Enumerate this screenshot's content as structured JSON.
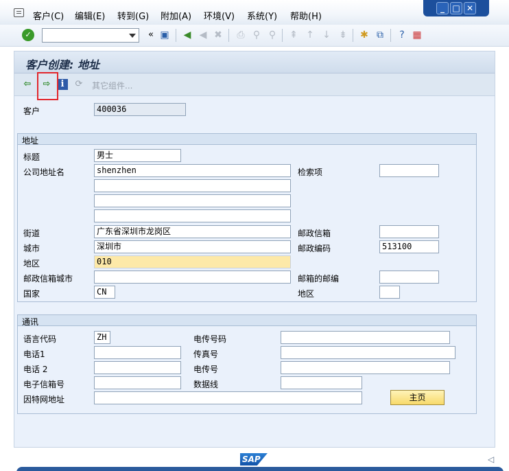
{
  "menu": {
    "items": [
      "客户(C)",
      "编辑(E)",
      "转到(G)",
      "附加(A)",
      "环境(V)",
      "系统(Y)",
      "帮助(H)"
    ]
  },
  "window_controls": [
    "_",
    "□",
    "✕"
  ],
  "toolbar": {
    "command_field_value": ""
  },
  "screen": {
    "title": "客户创建: 地址",
    "other_components_label": "其它组件..."
  },
  "customer": {
    "label": "客户",
    "value": "400036"
  },
  "address": {
    "group_title": "地址",
    "title_label": "标题",
    "title_value": "男士",
    "company_name_label": "公司地址名",
    "company_name_1": "shenzhen",
    "company_name_2": "",
    "company_name_3": "",
    "company_name_4": "",
    "search_term_label": "检索项",
    "search_term_value": "",
    "street_label": "街道",
    "street_value": "广东省深圳市龙岗区",
    "po_box_label": "邮政信箱",
    "po_box_value": "",
    "city_label": "城市",
    "city_value": "深圳市",
    "postal_code_label": "邮政编码",
    "postal_code_value": "513100",
    "district_label": "地区",
    "district_value": "010",
    "po_box_city_label": "邮政信箱城市",
    "po_box_city_value": "",
    "po_box_postal_label": "邮箱的邮编",
    "po_box_postal_value": "",
    "country_label": "国家",
    "country_value": "CN",
    "region_label": "地区",
    "region_value": ""
  },
  "communication": {
    "group_title": "通讯",
    "language_label": "语言代码",
    "language_value": "ZH",
    "telex_label": "电传号码",
    "telex_value": "",
    "phone1_label": "电话1",
    "phone1_value": "",
    "fax_label": "传真号",
    "fax_value": "",
    "phone2_label": "电话 2",
    "phone2_value": "",
    "teletex_label": "电传号",
    "teletex_value": "",
    "email_label": "电子信箱号",
    "email_value": "",
    "dataline_label": "数据线",
    "dataline_value": "",
    "internet_label": "因特网地址",
    "internet_value": "",
    "homepage_button": "主页"
  },
  "footer": {
    "logo_text": "SAP"
  }
}
